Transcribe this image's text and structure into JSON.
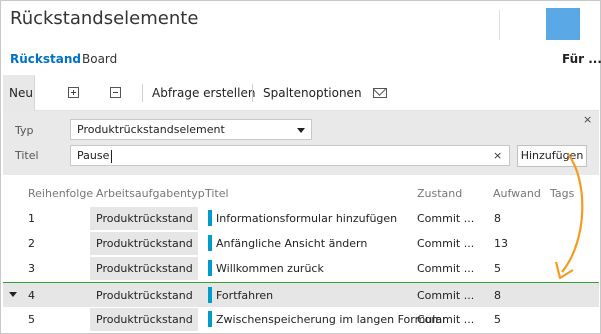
{
  "page": {
    "title": "Rückstandselemente"
  },
  "colors": {
    "accent": "#0072c6",
    "brand_square": "#5aa8e6",
    "pbi_bar": "#009ccc",
    "drop_line": "#33a133",
    "arrow": "#f49c20"
  },
  "nav": {
    "active": "Rückstand",
    "board": "Board",
    "right": "Für ..."
  },
  "toolbar": {
    "new_label": "Neu",
    "expand_icon": "expand-icon",
    "collapse_icon": "collapse-icon",
    "create_query": "Abfrage erstellen",
    "column_options": "Spaltenoptionen",
    "mail_icon": "mail-icon"
  },
  "form": {
    "close_symbol": "×",
    "type_label": "Typ",
    "type_value": "Produktrückstandselement",
    "title_label": "Titel",
    "title_value": "Pause",
    "clear_symbol": "×",
    "add_button": "Hinzufügen"
  },
  "grid": {
    "headers": {
      "order": "Reihenfolge",
      "type": "Arbeitsaufgabentyp",
      "title": "Titel",
      "state": "Zustand",
      "effort": "Aufwand",
      "tags": "Tags"
    },
    "rows": [
      {
        "order": "1",
        "type": "Produktrückstand",
        "title": "Informationsformular hinzufügen",
        "state": "Commit ...",
        "effort": "8"
      },
      {
        "order": "2",
        "type": "Produktrückstand",
        "title": "Anfängliche Ansicht ändern",
        "state": "Commit ...",
        "effort": "13"
      },
      {
        "order": "3",
        "type": "Produktrückstand",
        "title": "Willkommen zurück",
        "state": "Commit ...",
        "effort": "5"
      },
      {
        "order": "4",
        "type": "Produktrückstand",
        "title": "Fortfahren",
        "state": "Commit ...",
        "effort": "8"
      },
      {
        "order": "5",
        "type": "Produktrückstand",
        "title": "Zwischenspeicherung im langen Formular",
        "state": "Commit ...",
        "effort": "5"
      }
    ]
  }
}
